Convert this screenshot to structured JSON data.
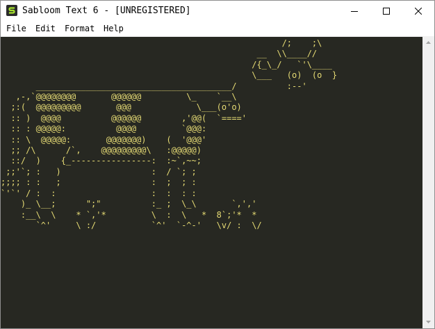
{
  "window": {
    "title": "Sabloom Text 6 - [UNREGISTERED]",
    "icon": "sabloom-s-icon",
    "controls": {
      "minimize_icon": "minimize-icon",
      "maximize_icon": "maximize-icon",
      "close_icon": "close-icon"
    }
  },
  "menu": {
    "items": [
      {
        "label": "File"
      },
      {
        "label": "Edit"
      },
      {
        "label": "Format"
      },
      {
        "label": "Help"
      }
    ]
  },
  "editor": {
    "background": "#272822",
    "text_color": "#e6db74",
    "content": "                                                        /;    ;\\\n                                                   __  \\\\____//\n                                                  /{_\\_/   `'\\____\n                                                  \\___   (o)  (o  }\n       _______________________________________/          :--'\n   ,-,`@@@@@@@@       @@@@@@         \\_    `__\\\n  ;:(  @@@@@@@@@       @@@             \\___(o'o)\n  :: )  @@@@          @@@@@@        ,'@@(  `===='\n  :: : @@@@@:          @@@@         `@@@:\n  :: \\  @@@@@:       @@@@@@@)    (  '@@@'\n  ;; /\\      /`,    @@@@@@@@@\\   :@@@@@)\n  ::/  )    {_----------------:  :~`,~~;\n ;;'`; :   )                  :  / `; ;\n;;;; : :   ;                  :  ;  ; :\n`'`' / :  :                   :  :  : :\n    )_ \\__;      \";\"          :_ ;  \\_\\       `,','\n    :__\\  \\    * `,'*         \\  :  \\   *  8`;'*  *\n       `^'     \\ :/           `^'  `-^-'   \\v/ :  \\/"
  },
  "scrollbar": {
    "up_icon": "scroll-up-arrow-icon",
    "down_icon": "scroll-down-arrow-icon"
  },
  "colors": {
    "titlebar": "#ffffff",
    "menubar": "#ffffff",
    "scrollbar_track": "#f0f0f0",
    "border": "#8e8e8e"
  }
}
